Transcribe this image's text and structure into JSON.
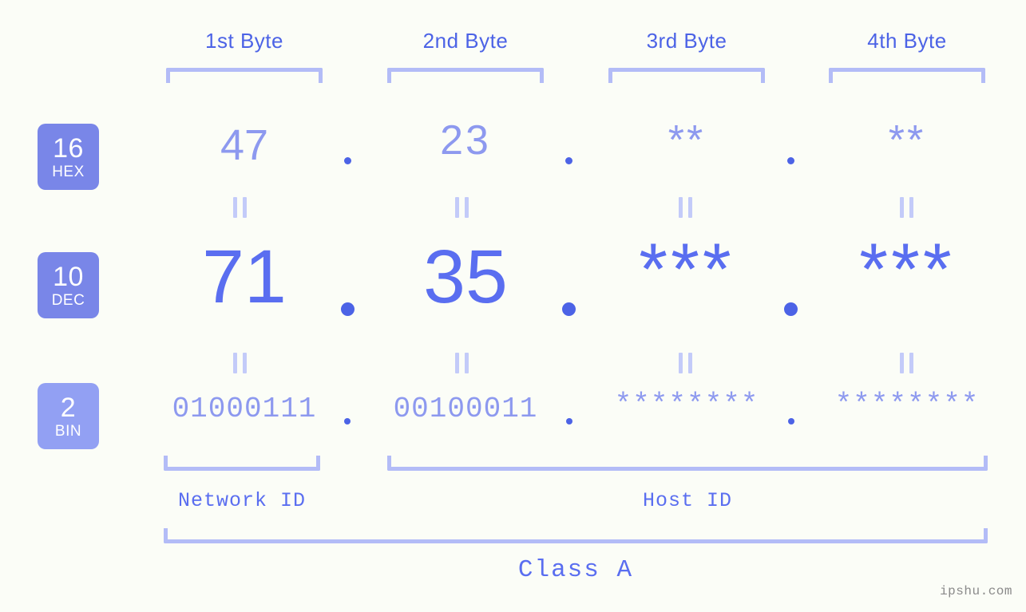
{
  "watermark": "ipshu.com",
  "headers": [
    {
      "label": "1st Byte"
    },
    {
      "label": "2nd Byte"
    },
    {
      "label": "3rd Byte"
    },
    {
      "label": "4th Byte"
    }
  ],
  "bases": [
    {
      "num": "16",
      "name": "HEX",
      "color": "#7986e8"
    },
    {
      "num": "10",
      "name": "DEC",
      "color": "#7986e8"
    },
    {
      "num": "2",
      "name": "BIN",
      "color": "#92a0f3"
    }
  ],
  "rows": {
    "hex": {
      "base": "16",
      "name": "HEX",
      "values": [
        "47",
        "23",
        "**",
        "**"
      ],
      "separator": "."
    },
    "dec": {
      "base": "10",
      "name": "DEC",
      "values": [
        "71",
        "35",
        "***",
        "***"
      ],
      "separator": "."
    },
    "bin": {
      "base": "2",
      "name": "BIN",
      "values": [
        "01000111",
        "00100011",
        "********",
        "********"
      ],
      "separator": "."
    }
  },
  "equals": {
    "symbol": "="
  },
  "segments": {
    "network_id": "Network ID",
    "host_id": "Host ID",
    "class": "Class A"
  },
  "colors": {
    "background": "#fbfdf7",
    "accent_strong": "#4c63e6",
    "accent_mid": "#5a6ef0",
    "accent_light": "#8d99ef",
    "bracket": "#b3bcf7",
    "badge_dark": "#7986e8",
    "badge_light": "#92a0f3",
    "watermark": "#8a8a8a"
  }
}
